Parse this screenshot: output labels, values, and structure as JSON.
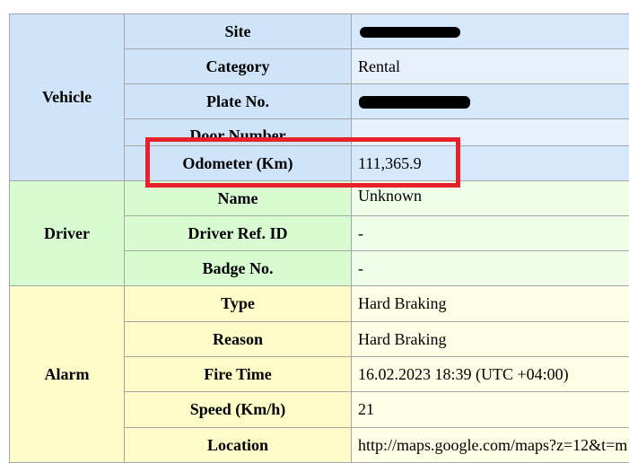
{
  "vehicle": {
    "group_label": "Vehicle",
    "rows": [
      {
        "label": "Site",
        "value": ""
      },
      {
        "label": "Category",
        "value": "Rental"
      },
      {
        "label": "Plate No.",
        "value": ""
      },
      {
        "label": "Door Number",
        "value": ""
      },
      {
        "label": "Odometer (Km)",
        "value": "111,365.9"
      }
    ]
  },
  "driver": {
    "group_label": "Driver",
    "rows": [
      {
        "label": "Name",
        "value": "Unknown"
      },
      {
        "label": "Driver Ref. ID",
        "value": "-"
      },
      {
        "label": "Badge No.",
        "value": "-"
      }
    ]
  },
  "alarm": {
    "group_label": "Alarm",
    "rows": [
      {
        "label": "Type",
        "value": "Hard Braking"
      },
      {
        "label": "Reason",
        "value": "Hard Braking"
      },
      {
        "label": "Fire Time",
        "value": "16.02.2023 18:39 (UTC +04:00)"
      },
      {
        "label": "Speed (Km/h)",
        "value": "21"
      },
      {
        "label": "Location",
        "value": "http://maps.google.com/maps?z=12&t=m"
      }
    ]
  },
  "colors": {
    "highlight_border": "#e8202a",
    "vehicle_bg": "#cfe4f9",
    "driver_bg": "#d8fbd2",
    "alarm_bg": "#fdfcc9",
    "redaction": "#000000"
  }
}
